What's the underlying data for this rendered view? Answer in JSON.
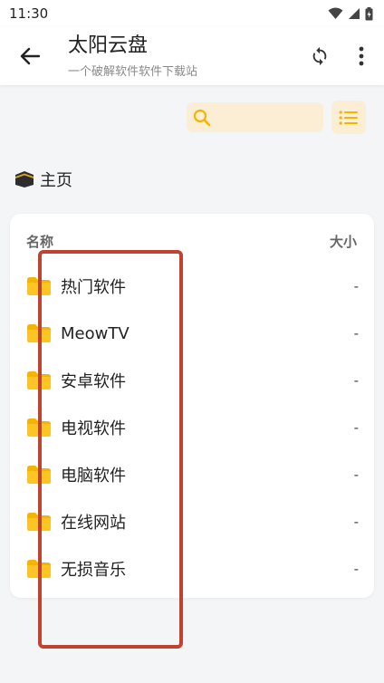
{
  "status_bar": {
    "time": "11:30",
    "icons": [
      "wifi-icon",
      "signal-icon",
      "battery-icon"
    ]
  },
  "app_bar": {
    "title": "太阳云盘",
    "subtitle": "一个破解软件软件下载站",
    "icons": [
      "back-arrow-icon",
      "refresh-icon",
      "more-vert-icon"
    ]
  },
  "search": {
    "value": "",
    "placeholder": ""
  },
  "breadcrumb": {
    "label": "主页",
    "icon": "kaaba-emoji-icon"
  },
  "file_list": {
    "headers": {
      "name": "名称",
      "size": "大小"
    },
    "rows": [
      {
        "name": "热门软件",
        "size": "-"
      },
      {
        "name": "MeowTV",
        "size": "-"
      },
      {
        "name": "安卓软件",
        "size": "-"
      },
      {
        "name": "电视软件",
        "size": "-"
      },
      {
        "name": "电脑软件",
        "size": "-"
      },
      {
        "name": "在线网站",
        "size": "-"
      },
      {
        "name": "无损音乐",
        "size": "-"
      }
    ]
  },
  "colors": {
    "accent": "#f4b400",
    "accent_bg": "#fbeed5",
    "highlight": "#c0432f",
    "background": "#f4f5f7"
  }
}
